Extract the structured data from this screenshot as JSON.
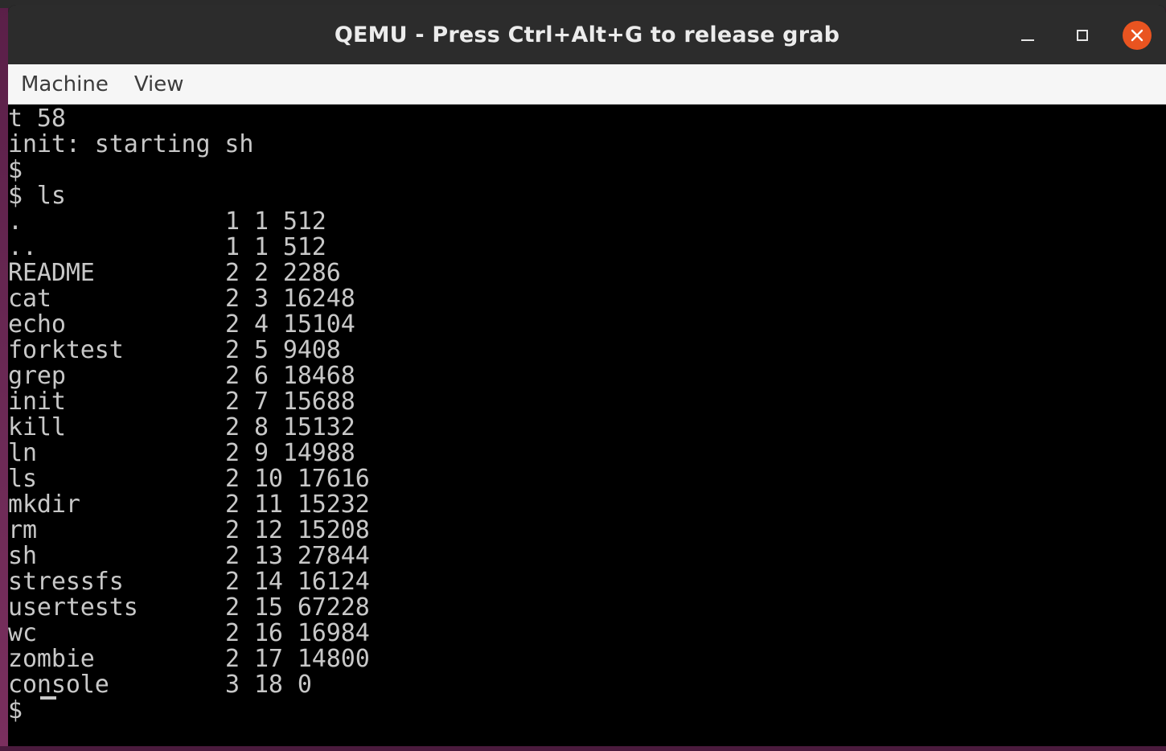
{
  "window": {
    "title": "QEMU - Press Ctrl+Alt+G to release grab",
    "controls": {
      "minimize_icon": "window-minimize-icon",
      "maximize_icon": "window-maximize-icon",
      "close_icon": "window-close-icon",
      "close_color": "#e95420"
    }
  },
  "menubar": {
    "items": [
      {
        "label": "Machine"
      },
      {
        "label": "View"
      }
    ]
  },
  "console": {
    "pre_lines": [
      "t 58",
      "init: starting sh",
      "$",
      "$ ls"
    ],
    "ls_entries": [
      {
        "name": ".",
        "type": "1",
        "inode": "1",
        "size": "512"
      },
      {
        "name": "..",
        "type": "1",
        "inode": "1",
        "size": "512"
      },
      {
        "name": "README",
        "type": "2",
        "inode": "2",
        "size": "2286"
      },
      {
        "name": "cat",
        "type": "2",
        "inode": "3",
        "size": "16248"
      },
      {
        "name": "echo",
        "type": "2",
        "inode": "4",
        "size": "15104"
      },
      {
        "name": "forktest",
        "type": "2",
        "inode": "5",
        "size": "9408"
      },
      {
        "name": "grep",
        "type": "2",
        "inode": "6",
        "size": "18468"
      },
      {
        "name": "init",
        "type": "2",
        "inode": "7",
        "size": "15688"
      },
      {
        "name": "kill",
        "type": "2",
        "inode": "8",
        "size": "15132"
      },
      {
        "name": "ln",
        "type": "2",
        "inode": "9",
        "size": "14988"
      },
      {
        "name": "ls",
        "type": "2",
        "inode": "10",
        "size": "17616"
      },
      {
        "name": "mkdir",
        "type": "2",
        "inode": "11",
        "size": "15232"
      },
      {
        "name": "rm",
        "type": "2",
        "inode": "12",
        "size": "15208"
      },
      {
        "name": "sh",
        "type": "2",
        "inode": "13",
        "size": "27844"
      },
      {
        "name": "stressfs",
        "type": "2",
        "inode": "14",
        "size": "16124"
      },
      {
        "name": "usertests",
        "type": "2",
        "inode": "15",
        "size": "67228"
      },
      {
        "name": "wc",
        "type": "2",
        "inode": "16",
        "size": "16984"
      },
      {
        "name": "zombie",
        "type": "2",
        "inode": "17",
        "size": "14800"
      },
      {
        "name": "console",
        "type": "3",
        "inode": "18",
        "size": "0"
      }
    ],
    "prompt": "$ "
  }
}
